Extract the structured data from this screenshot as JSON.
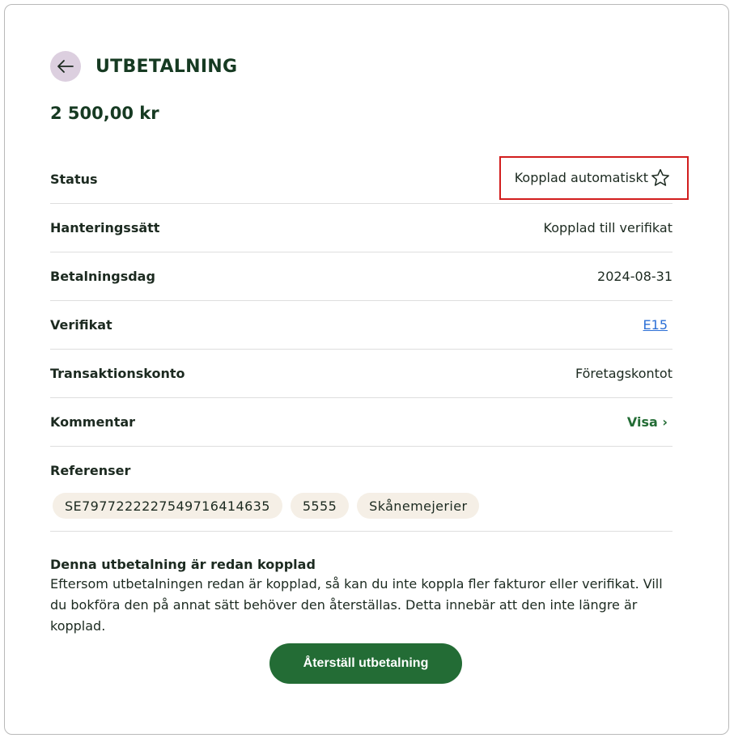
{
  "header": {
    "title": "UTBETALNING",
    "back_icon": "arrow-left-icon"
  },
  "amount": "2 500,00 kr",
  "rows": {
    "status": {
      "label": "Status",
      "value": "Kopplad automatiskt",
      "icon": "star-outline-icon"
    },
    "handling": {
      "label": "Hanteringssätt",
      "value": "Kopplad till verifikat"
    },
    "payment_date": {
      "label": "Betalningsdag",
      "value": "2024-08-31"
    },
    "voucher": {
      "label": "Verifikat",
      "value": "E15"
    },
    "account": {
      "label": "Transaktionskonto",
      "value": "Företagskontot"
    },
    "comment": {
      "label": "Kommentar",
      "value": "Visa ›"
    }
  },
  "references": {
    "label": "Referenser",
    "items": [
      "SE797722222754971641​4635",
      "5555",
      "Skånemejerier"
    ]
  },
  "notice": {
    "title": "Denna utbetalning är redan kopplad",
    "text": "Eftersom utbetalningen redan är kopplad, så kan du inte koppla fler fakturor eller verifikat. Vill du bokföra den på annat sätt behöver den återställas. Detta innebär att den inte längre är kopplad."
  },
  "actions": {
    "reset_label": "Återställ utbetalning"
  },
  "colors": {
    "primary": "#236c35",
    "title": "#163a22",
    "back_bg": "#dccfdf",
    "chip_bg": "#f5efe6",
    "highlight": "#d21d1d",
    "link": "#2b6fd6"
  }
}
